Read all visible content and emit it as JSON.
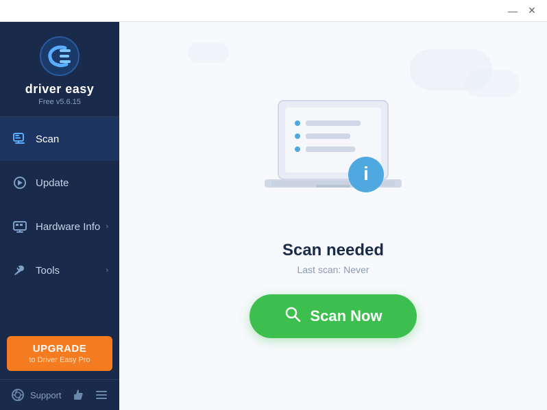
{
  "titlebar": {
    "minimize_label": "—",
    "close_label": "✕"
  },
  "sidebar": {
    "logo_text": "driver easy",
    "logo_version": "Free v5.6.15",
    "nav_items": [
      {
        "id": "scan",
        "label": "Scan",
        "icon": "scan",
        "active": true,
        "has_chevron": false
      },
      {
        "id": "update",
        "label": "Update",
        "icon": "update",
        "active": false,
        "has_chevron": false
      },
      {
        "id": "hardware-info",
        "label": "Hardware Info",
        "icon": "hardware",
        "active": false,
        "has_chevron": true
      },
      {
        "id": "tools",
        "label": "Tools",
        "icon": "tools",
        "active": false,
        "has_chevron": true
      }
    ],
    "upgrade": {
      "title": "UPGRADE",
      "subtitle": "to Driver Easy Pro"
    },
    "footer": {
      "support_label": "Support"
    }
  },
  "main": {
    "scan_needed": "Scan needed",
    "last_scan_label": "Last scan: Never",
    "scan_now_label": "Scan Now"
  }
}
